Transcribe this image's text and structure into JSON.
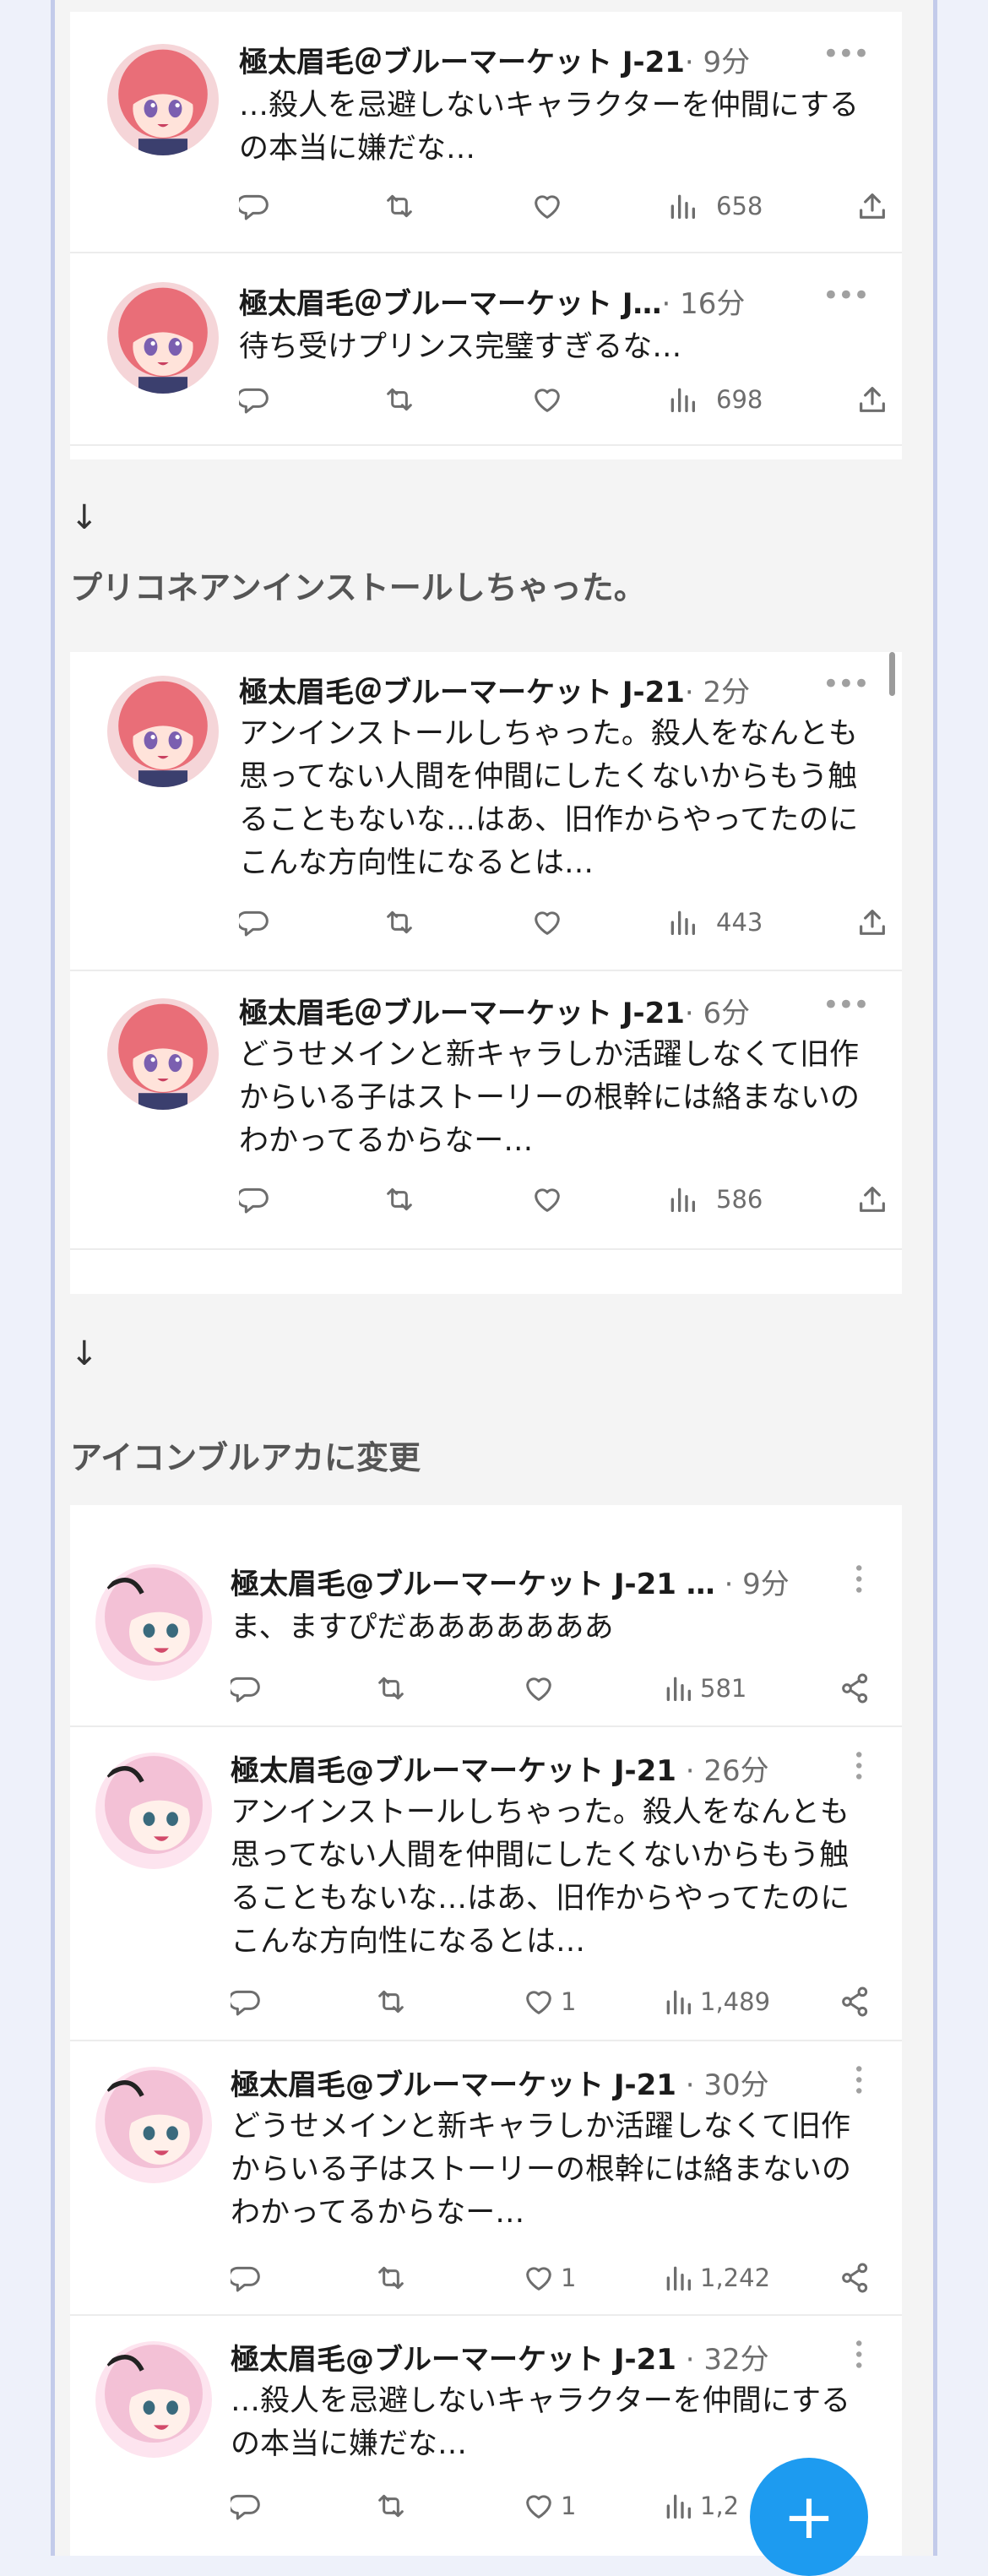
{
  "colors": {
    "accent": "#1d9bf0",
    "text": "#1b1b1b",
    "meta": "#6e6e6e",
    "page_bg": "#f4f4f4"
  },
  "group1": {
    "tweets": [
      {
        "name": "極太眉毛＠ブルーマーケット J-21",
        "time": "· 9分",
        "text": "…殺人を忌避しないキャラクターを仲間にするの本当に嫌だな…",
        "views": "658"
      },
      {
        "name": "極太眉毛＠ブルーマーケット J…",
        "time": "· 16分",
        "text": "待ち受けプリンス完璧すぎるな…",
        "views": "698"
      }
    ]
  },
  "arrow1": "↓",
  "section1": "プリコネアンインストールしちゃった。",
  "group2": {
    "tweets": [
      {
        "name": "極太眉毛＠ブルーマーケット J-21",
        "time": "· 2分",
        "text": "アンインストールしちゃった。殺人をなんとも思ってない人間を仲間にしたくないからもう触ることもないな…はあ、旧作からやってたのにこんな方向性になるとは…",
        "views": "443"
      },
      {
        "name": "極太眉毛＠ブルーマーケット J-21",
        "time": "· 6分",
        "text": "どうせメインと新キャラしか活躍しなくて旧作からいる子はストーリーの根幹には絡まないのわかってるからなー…",
        "views": "586"
      }
    ]
  },
  "arrow2": "↓",
  "section2": "アイコンブルアカに変更",
  "group3": {
    "tweets": [
      {
        "name": "極太眉毛@ブルーマーケット J-21 …",
        "time": "· 9分",
        "text": "ま、ますぴだあああああああ",
        "likes": "",
        "views": "581"
      },
      {
        "name": "極太眉毛@ブルーマーケット J-21",
        "time": "· 26分",
        "text": "アンインストールしちゃった。殺人をなんとも思ってない人間を仲間にしたくないからもう触ることもないな…はあ、旧作からやってたのにこんな方向性になるとは…",
        "likes": "1",
        "views": "1,489"
      },
      {
        "name": "極太眉毛@ブルーマーケット J-21",
        "time": "· 30分",
        "text": "どうせメインと新キャラしか活躍しなくて旧作からいる子はストーリーの根幹には絡まないのわかってるからなー…",
        "likes": "1",
        "views": "1,242"
      },
      {
        "name": "極太眉毛@ブルーマーケット J-21",
        "time": "· 32分",
        "text": "…殺人を忌避しないキャラクターを仲間にするの本当に嫌だな…",
        "likes": "1",
        "views": "1,2"
      }
    ]
  },
  "fab_label": "+",
  "icons": [
    "reply-icon",
    "retweet-icon",
    "like-icon",
    "views-icon",
    "share-icon",
    "more-icon",
    "compose-icon"
  ]
}
